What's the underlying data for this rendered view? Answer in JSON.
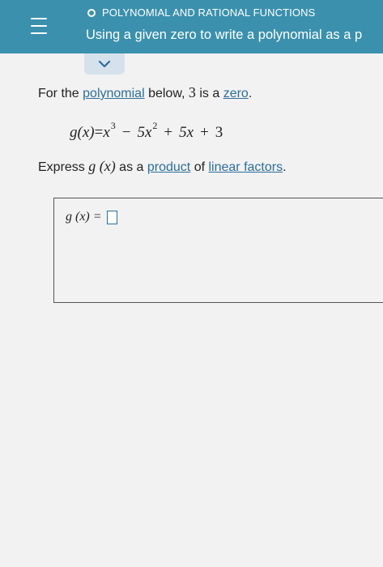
{
  "header": {
    "topic": "POLYNOMIAL AND RATIONAL FUNCTIONS",
    "lesson_title": "Using a given zero to write a polynomial as a p",
    "menu_icon": "hamburger-menu-icon",
    "collapse_icon": "chevron-down-icon",
    "color": "#3a90ad"
  },
  "problem": {
    "intro_prefix": "For the ",
    "intro_link_polynomial": "polynomial",
    "intro_middle": " below, ",
    "intro_number": "3",
    "intro_is_a": " is a ",
    "intro_link_zero": "zero",
    "intro_suffix": ".",
    "equation": {
      "lhs": "g(x)",
      "equals": "=",
      "t1": "x",
      "t1_exp": "3",
      "op1": "−",
      "t2": "5x",
      "t2_exp": "2",
      "op2": "+",
      "t3": "5x",
      "op3": "+",
      "t4": "3"
    },
    "instruction_prefix": "Express ",
    "instruction_func": "g (x)",
    "instruction_middle": " as a ",
    "instruction_link_product": "product",
    "instruction_of": " of ",
    "instruction_link_linear": "linear factors",
    "instruction_suffix": "."
  },
  "answer": {
    "label": "g (x) = ",
    "value": ""
  }
}
